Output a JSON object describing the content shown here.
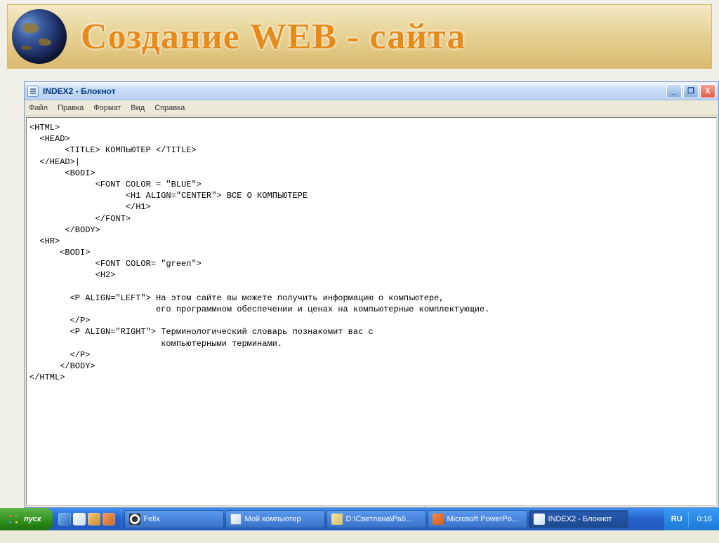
{
  "banner": {
    "title": "Создание WEB - сайта"
  },
  "notepad": {
    "title": "INDEX2 - Блокнот",
    "menu": [
      "Файл",
      "Правка",
      "Формат",
      "Вид",
      "Справка"
    ],
    "code": "<HTML>\n  <HEAD>\n       <TITLE> КОМПЬЮТЕР </TITLE>\n  </HEAD>|\n       <BODI>\n             <FONT COLOR = \"BLUE\">\n                   <H1 ALIGN=\"CENTER\"> ВСЕ О КОМПЬЮТЕРЕ\n                   </H1>\n             </FONT>\n       </BODY>\n  <HR>\n      <BODI>\n             <FONT COLOR= \"green\">\n             <H2>\n\n        <P ALIGN=\"LEFT\"> На этом сайте вы можете получить информацию о компьютере,\n                         его программном обеспечении и ценах на компьютерные комплектующие.\n        </P>\n        <P ALIGN=\"RIGHT\"> Терминологический словарь познакомит вас с\n                          компьютерными терминами.\n        </P>\n      </BODY>\n</HTML>"
  },
  "window_controls": {
    "min": "_",
    "max": "❐",
    "close": "X"
  },
  "taskbar": {
    "start": "пуск",
    "tasks": [
      {
        "label": "Felix",
        "active": false
      },
      {
        "label": "Мой компьютер",
        "active": false
      },
      {
        "label": "D:\\Светлана\\Раб...",
        "active": false
      },
      {
        "label": "Microsoft PowerPo...",
        "active": false
      },
      {
        "label": "INDEX2 - Блокнот",
        "active": true
      }
    ],
    "tray": {
      "lang": "RU",
      "time": "0:16"
    }
  }
}
